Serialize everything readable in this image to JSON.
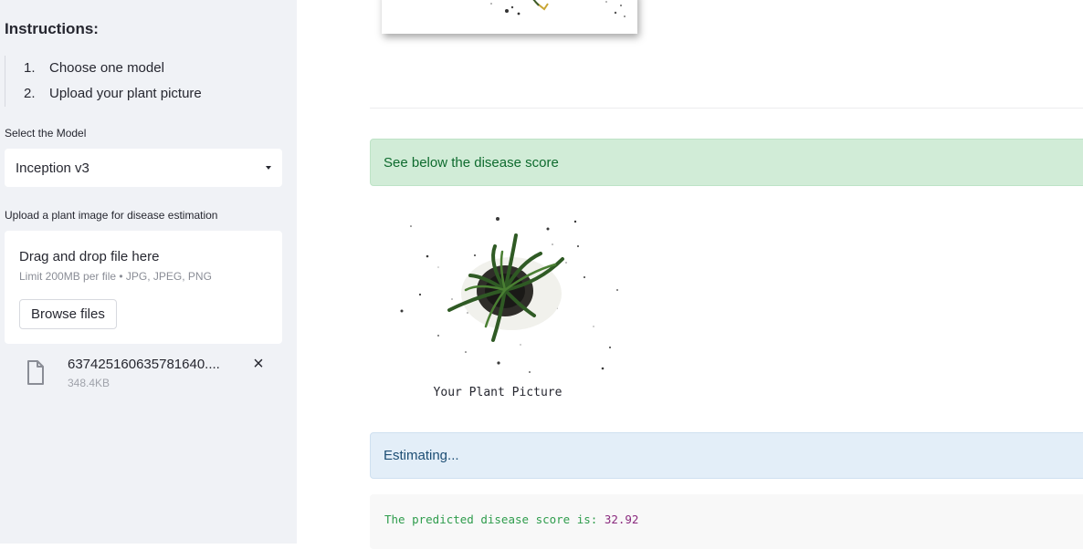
{
  "sidebar": {
    "instructions_title": "Instructions:",
    "steps": [
      {
        "num": "1.",
        "text": "Choose one model"
      },
      {
        "num": "2.",
        "text": "Upload your plant picture"
      }
    ],
    "model_label": "Select the Model",
    "model_selected": "Inception v3",
    "upload_label": "Upload a plant image for disease estimation",
    "dropzone": {
      "text": "Drag and drop file here",
      "limit": "Limit 200MB per file • JPG, JPEG, PNG",
      "browse_label": "Browse files"
    },
    "uploaded_file": {
      "name": "637425160635781640....",
      "size": "348.4KB",
      "remove_icon": "×"
    }
  },
  "main": {
    "success_message": "See below the disease score",
    "image_caption": "Your Plant Picture",
    "info_message": "Estimating...",
    "result": {
      "prefix": "The predicted disease score is: ",
      "value": "32.92"
    }
  },
  "colors": {
    "sidebar_bg": "#f0f2f6",
    "success_bg": "#d1ecd7",
    "success_text": "#0e6b2e",
    "info_bg": "#e3eef8",
    "info_text": "#1d4e74",
    "code_green": "#2e9c4c",
    "code_purple": "#8a2a7e"
  }
}
